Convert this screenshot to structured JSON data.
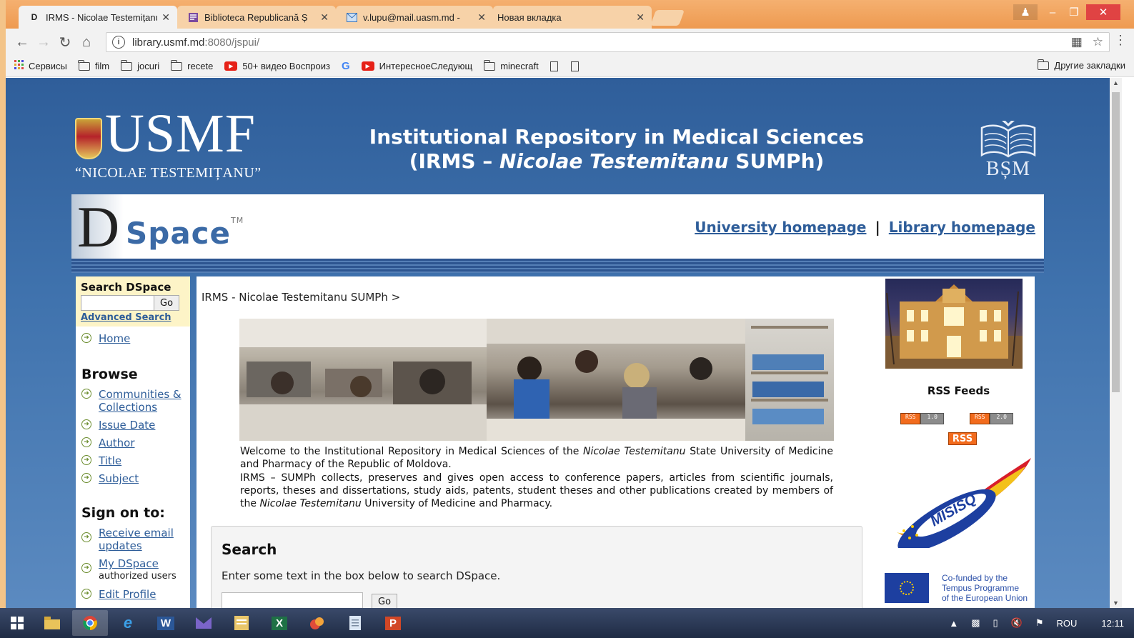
{
  "browser": {
    "tabs": [
      {
        "title": "IRMS - Nicolae Testemițanu",
        "favicon": "D",
        "active": true
      },
      {
        "title": "Biblioteca Republicană Ș",
        "favicon": "book",
        "active": false
      },
      {
        "title": "v.lupu@mail.uasm.md -",
        "favicon": "mail",
        "active": false
      },
      {
        "title": "Новая вкладка",
        "favicon": "",
        "active": false
      }
    ],
    "close_glyph": "✕",
    "url_host": "library.usmf.md",
    "url_rest": ":8080/jspui/",
    "bookmarks": [
      {
        "label": "Сервисы",
        "icon": "apps-icon"
      },
      {
        "label": "film",
        "icon": "folder-icon"
      },
      {
        "label": "jocuri",
        "icon": "folder-icon"
      },
      {
        "label": "recete",
        "icon": "folder-icon"
      },
      {
        "label": "50+ видео Воспроиз",
        "icon": "youtube-icon"
      },
      {
        "label": "",
        "icon": "google-icon"
      },
      {
        "label": "ИнтересноеСледующ",
        "icon": "youtube-icon"
      },
      {
        "label": "minecraft",
        "icon": "folder-icon"
      }
    ],
    "other_bookmarks": "Другие закладки",
    "accent": "#ee9a50"
  },
  "header": {
    "usmf_name": "USMF",
    "usmf_sub": "“NICOLAE TESTEMIȚANU”",
    "title_line1": "Institutional Repository in Medical Sciences",
    "title_line2_pre": "(IRMS – ",
    "title_line2_em": "Nicolae Testemitanu",
    "title_line2_post": " SUMPh)",
    "bsm": "BȘM",
    "dspace_d": "D",
    "dspace_text": "Space",
    "dspace_tm": "TM",
    "link_university": "University homepage",
    "separator": "|",
    "link_library": "Library homepage"
  },
  "leftnav": {
    "search_title": "Search DSpace",
    "go": "Go",
    "advanced": "Advanced Search",
    "home": "Home",
    "browse_title": "Browse",
    "browse_items": [
      "Communities & Collections",
      "Issue Date",
      "Author",
      "Title",
      "Subject"
    ],
    "signon_title": "Sign on to:",
    "receive_email": "Receive email updates",
    "my_dspace": "My DSpace",
    "my_dspace_note": "authorized users",
    "edit_profile": "Edit Profile"
  },
  "main": {
    "breadcrumb": "IRMS - Nicolae Testemitanu SUMPh >",
    "intro_p1_pre": "Welcome to the Institutional Repository in Medical Sciences of the ",
    "intro_p1_em": "Nicolae Testemitanu",
    "intro_p1_post": " State University of Medicine and Pharmacy of the Republic of Moldova.",
    "intro_p2_pre": "IRMS – SUMPh collects, preserves and gives open access to conference papers, articles from scientific journals, reports, theses and dissertations, study aids, patents, student theses and other publications cre­ated by members of the ",
    "intro_p2_em": "Nicolae Testemitanu",
    "intro_p2_post": " University of Medicine and Pharmacy.",
    "search_heading": "Search",
    "search_desc": "Enter some text in the box below to search DSpace.",
    "go": "Go"
  },
  "rightcol": {
    "rss_heading": "RSS Feeds",
    "rss_left": "RSS",
    "rss1_ver": "1.0",
    "rss2_ver": "2.0",
    "rss_big": "RSS",
    "misiso": "MISISQ",
    "eu_line1": "Co-funded by the",
    "eu_line2": "Tempus Programme",
    "eu_line3": "of the European Union"
  },
  "taskbar": {
    "apps": [
      "explorer",
      "chrome",
      "ie",
      "word",
      "mail",
      "files",
      "excel",
      "paint",
      "notepad",
      "powerpoint"
    ],
    "lang": "ROU",
    "time": "12:11"
  }
}
